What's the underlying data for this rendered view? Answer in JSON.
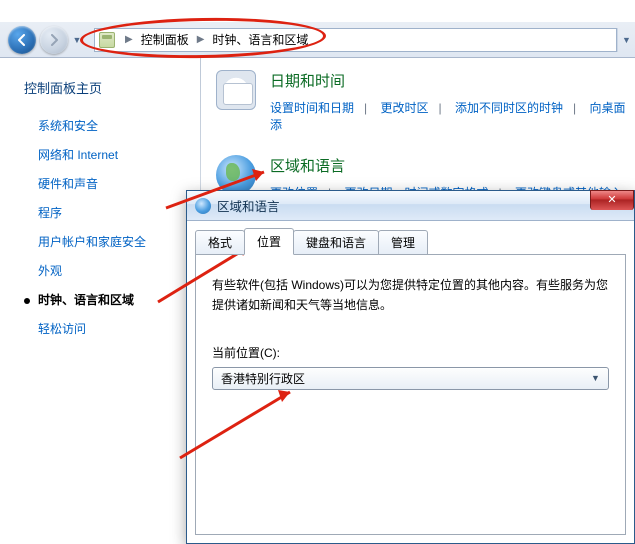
{
  "addressbar": {
    "crumbs": [
      "控制面板",
      "时钟、语言和区域"
    ]
  },
  "leftpane": {
    "heading": "控制面板主页",
    "items": [
      {
        "label": "系统和安全",
        "active": false
      },
      {
        "label": "网络和 Internet",
        "active": false
      },
      {
        "label": "硬件和声音",
        "active": false
      },
      {
        "label": "程序",
        "active": false
      },
      {
        "label": "用户帐户和家庭安全",
        "active": false
      },
      {
        "label": "外观",
        "active": false
      },
      {
        "label": "时钟、语言和区域",
        "active": true
      },
      {
        "label": "轻松访问",
        "active": false
      }
    ]
  },
  "categories": [
    {
      "icon": "clock",
      "title": "日期和时间",
      "links": [
        "设置时间和日期",
        "更改时区",
        "添加不同时区的时钟",
        "向桌面添"
      ]
    },
    {
      "icon": "globe",
      "title": "区域和语言",
      "links": [
        "更改位置",
        "更改日期、时间或数字格式",
        "更改键盘或其他输入法"
      ]
    }
  ],
  "dialog": {
    "title": "区域和语言",
    "tabs": [
      "格式",
      "位置",
      "键盘和语言",
      "管理"
    ],
    "active_tab_index": 1,
    "panel": {
      "description": "有些软件(包括 Windows)可以为您提供特定位置的其他内容。有些服务为您提供诸如新闻和天气等当地信息。",
      "location_label": "当前位置(C):",
      "location_value": "香港特别行政区"
    }
  }
}
